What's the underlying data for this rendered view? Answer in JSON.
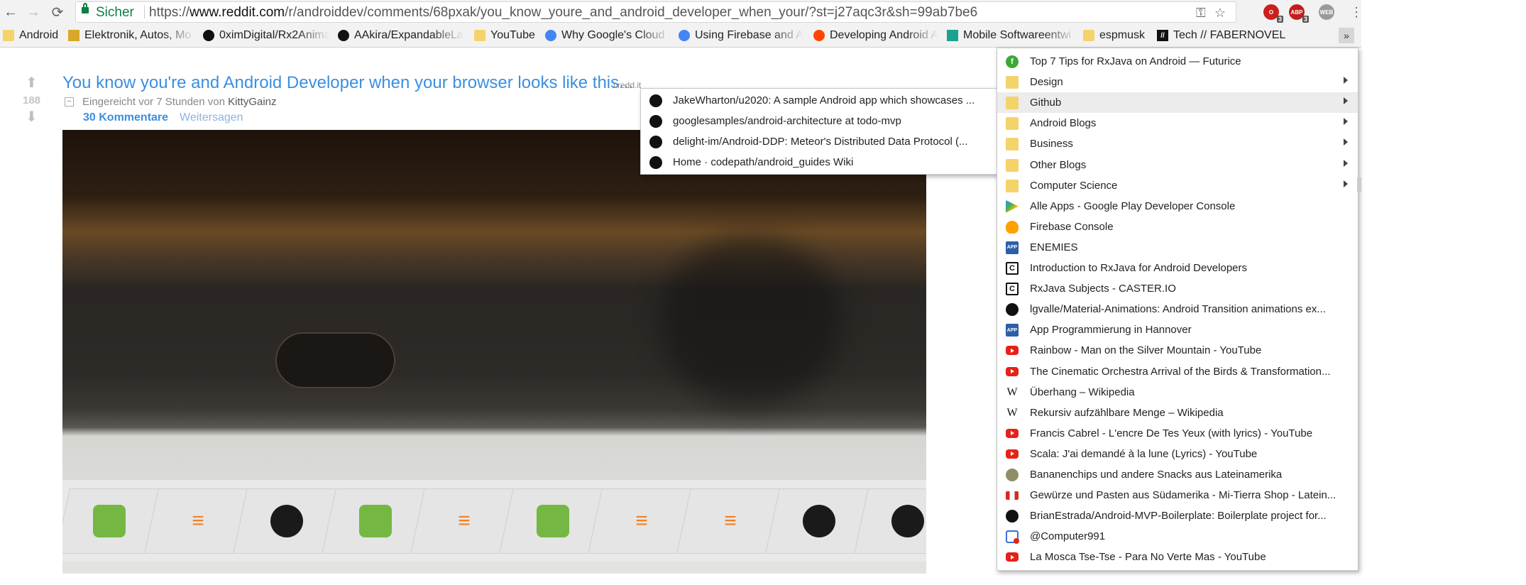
{
  "browser": {
    "secure_label": "Sicher",
    "url_scheme": "https://",
    "url_host": "www.reddit.com",
    "url_path": "/r/androiddev/comments/68pxak/you_know_youre_and_android_developer_when_your/?st=j27aqc3r&sh=99ab7be6",
    "extensions": [
      {
        "name": "opera-ext",
        "badge": "3",
        "color": "#cc1f1f"
      },
      {
        "name": "abp-ext",
        "label": "ABP",
        "badge": "3",
        "color": "#c41d1d"
      },
      {
        "name": "web-ext",
        "label": "WEB",
        "color": "#9a9a9a"
      }
    ]
  },
  "bookmarks_bar": {
    "items": [
      {
        "label": "Android",
        "icon": "folder-icon"
      },
      {
        "label": "Elektronik, Autos, Mo",
        "icon": "shop-icon"
      },
      {
        "label": "0ximDigital/Rx2Anima",
        "icon": "github-icon"
      },
      {
        "label": "AAkira/ExpandableLay",
        "icon": "github-icon"
      },
      {
        "label": "YouTube",
        "icon": "folder-icon"
      },
      {
        "label": "Why Google's Cloud I",
        "icon": "google-cloud-icon"
      },
      {
        "label": "Using Firebase and Ap",
        "icon": "google-cloud-icon"
      },
      {
        "label": "Developing Android A",
        "icon": "reddit-icon"
      },
      {
        "label": "Mobile Softwareentwi",
        "icon": "arrow-logo-icon"
      },
      {
        "label": "espmusk",
        "icon": "folder-icon"
      },
      {
        "label": "Tech // FABERNOVEL",
        "icon": "fabernovel-icon"
      }
    ],
    "overflow_label": "»"
  },
  "post": {
    "score": "188",
    "title": "You know you're and Android Developer when your browser looks like this...",
    "domain": "i.redd.it",
    "collapse_label": "–",
    "submitted_prefix": "Eingereicht vor 7 Stunden von ",
    "author": "KittyGainz",
    "comments_label": "30 Kommentare",
    "share_label": "Weitersagen"
  },
  "photo_tabs": [
    "android",
    "stackoverflow",
    "github",
    "android",
    "stackoverflow",
    "android",
    "stackoverflow",
    "stackoverflow",
    "github",
    "github"
  ],
  "github_submenu": {
    "items": [
      "JakeWharton/u2020: A sample Android app which showcases ...",
      "googlesamples/android-architecture at todo-mvp",
      "delight-im/Android-DDP: Meteor's Distributed Data Protocol (...",
      "Home · codepath/android_guides Wiki"
    ]
  },
  "bookmarks_menu": {
    "items": [
      {
        "label": "Top 7 Tips for RxJava on Android — Futurice",
        "icon": "futurice-icon"
      },
      {
        "label": "Design",
        "icon": "folder-icon",
        "submenu": true
      },
      {
        "label": "Github",
        "icon": "folder-icon",
        "submenu": true,
        "highlighted": true
      },
      {
        "label": "Android Blogs",
        "icon": "folder-icon",
        "submenu": true
      },
      {
        "label": "Business",
        "icon": "folder-icon",
        "submenu": true
      },
      {
        "label": "Other Blogs",
        "icon": "folder-icon",
        "submenu": true
      },
      {
        "label": "Computer Science",
        "icon": "folder-icon",
        "submenu": true
      },
      {
        "label": "Alle Apps - Google Play Developer Console",
        "icon": "google-play-icon"
      },
      {
        "label": "Firebase Console",
        "icon": "firebase-icon"
      },
      {
        "label": "ENEMIES",
        "icon": "app-icon"
      },
      {
        "label": "Introduction to RxJava for Android Developers",
        "icon": "caster-icon"
      },
      {
        "label": "RxJava Subjects - CASTER.IO",
        "icon": "caster-icon"
      },
      {
        "label": "lgvalle/Material-Animations: Android Transition animations ex...",
        "icon": "github-icon"
      },
      {
        "label": "App Programmierung in Hannover",
        "icon": "app-icon"
      },
      {
        "label": "Rainbow - Man on the Silver Mountain - YouTube",
        "icon": "youtube-icon"
      },
      {
        "label": "The Cinematic Orchestra Arrival of the Birds & Transformation...",
        "icon": "youtube-icon"
      },
      {
        "label": "Überhang – Wikipedia",
        "icon": "wikipedia-icon"
      },
      {
        "label": "Rekursiv aufzählbare Menge – Wikipedia",
        "icon": "wikipedia-icon"
      },
      {
        "label": "Francis Cabrel - L'encre De Tes Yeux (with lyrics) - YouTube",
        "icon": "youtube-icon"
      },
      {
        "label": "Scala: J'ai demandé à la lune (Lyrics) - YouTube",
        "icon": "youtube-icon"
      },
      {
        "label": "Bananenchips und andere Snacks aus Lateinamerika",
        "icon": "banana-icon"
      },
      {
        "label": "Gewürze und Pasten aus Südamerika - Mi-Tierra Shop - Latein...",
        "icon": "flag-icon"
      },
      {
        "label": "BrianEstrada/Android-MVP-Boilerplate: Boilerplate project for...",
        "icon": "github-icon"
      },
      {
        "label": "@Computer991",
        "icon": "twitter-notification-icon"
      },
      {
        "label": "La Mosca Tse-Tse - Para No Verte Mas - YouTube",
        "icon": "youtube-icon"
      }
    ]
  }
}
